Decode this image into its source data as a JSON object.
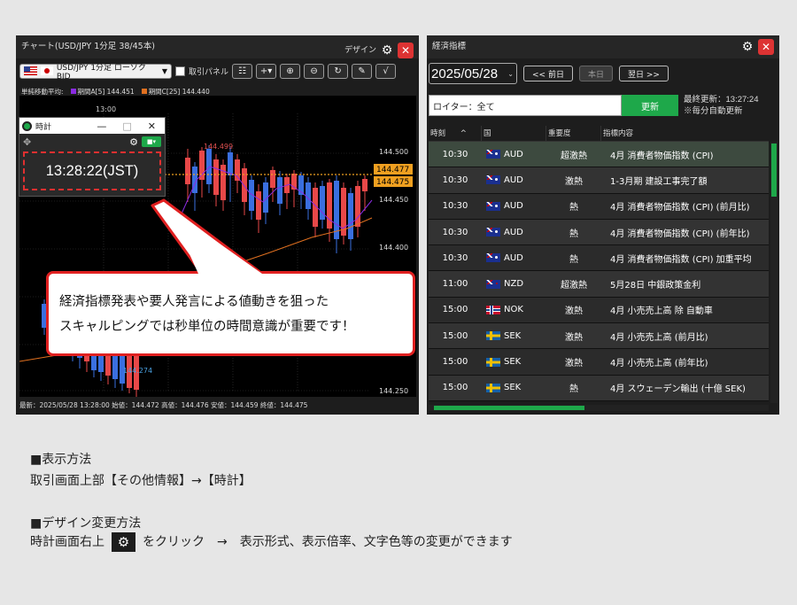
{
  "chart_panel": {
    "title": "チャート(USD/JPY 1分足 38/45本)",
    "design_label": "デザイン",
    "symbol_select": "USD/JPY 1分足 ローソク BID",
    "trade_panel_label": "取引パネル",
    "legend": {
      "ma_label": "単純移動平均:",
      "ma_a": "期間A[5] 144.451",
      "ma_c": "期間C[25] 144.440",
      "ma_a_color": "#8a2be2",
      "ma_c_color": "#e07020"
    },
    "time_label": "13:00",
    "high_label": "144.499",
    "low_label": "144.274",
    "price_ticks": [
      "144.500",
      "144.450",
      "144.400",
      "144.250"
    ],
    "price_tag_1": "144.477",
    "price_tag_2": "144.475",
    "status": "最新：2025/05/28 13:28:00 始値：144.472 高値：144.476 安値：144.459 終値：144.475"
  },
  "clock": {
    "title": "時計",
    "minimize": "—",
    "maximize": "□",
    "close": "✕",
    "time": "13:28:22(JST)"
  },
  "callout": {
    "line1": "経済指標発表や要人発言による値動きを狙った",
    "line2": "スキャルピングでは秒単位の時間意識が重要です！"
  },
  "calendar": {
    "title": "経済指標",
    "date": "2025/05/28",
    "prev_label": "<< 前日",
    "today_label": "本日",
    "next_label": "翌日 >>",
    "filter": "ロイター：全て",
    "update_label": "更新",
    "last_update": "最終更新：13:27:24",
    "auto_note": "※毎分自動更新",
    "columns": [
      "時刻",
      "国",
      "重要度",
      "指標内容"
    ],
    "rows": [
      {
        "time": "10:30",
        "country": "AUD",
        "flag": "au",
        "importance": "超激熱",
        "name": "4月 消費者物価指数 (CPI)"
      },
      {
        "time": "10:30",
        "country": "AUD",
        "flag": "au",
        "importance": "激熱",
        "name": "1-3月期 建設工事完了額"
      },
      {
        "time": "10:30",
        "country": "AUD",
        "flag": "au",
        "importance": "熱",
        "name": "4月 消費者物価指数 (CPI) (前月比)"
      },
      {
        "time": "10:30",
        "country": "AUD",
        "flag": "au",
        "importance": "熱",
        "name": "4月 消費者物価指数 (CPI) (前年比)"
      },
      {
        "time": "10:30",
        "country": "AUD",
        "flag": "au",
        "importance": "熱",
        "name": "4月 消費者物価指数 (CPI) 加重平均"
      },
      {
        "time": "11:00",
        "country": "NZD",
        "flag": "nz",
        "importance": "超激熱",
        "name": "5月28日 中銀政策金利"
      },
      {
        "time": "15:00",
        "country": "NOK",
        "flag": "no",
        "importance": "激熱",
        "name": "4月 小売売上高 除 自動車"
      },
      {
        "time": "15:00",
        "country": "SEK",
        "flag": "se",
        "importance": "激熱",
        "name": "4月 小売売上高 (前月比)"
      },
      {
        "time": "15:00",
        "country": "SEK",
        "flag": "se",
        "importance": "激熱",
        "name": "4月 小売売上高 (前年比)"
      },
      {
        "time": "15:00",
        "country": "SEK",
        "flag": "se",
        "importance": "熱",
        "name": "4月 スウェーデン輸出 (十億 SEK)"
      }
    ]
  },
  "instructions": {
    "h1": "■表示方法",
    "p1": "取引画面上部【その他情報】→【時計】",
    "h2": "■デザイン変更方法",
    "p2a": "時計画面右上",
    "p2b": "をクリック　→　表示形式、表示倍率、文字色等の変更ができます"
  }
}
